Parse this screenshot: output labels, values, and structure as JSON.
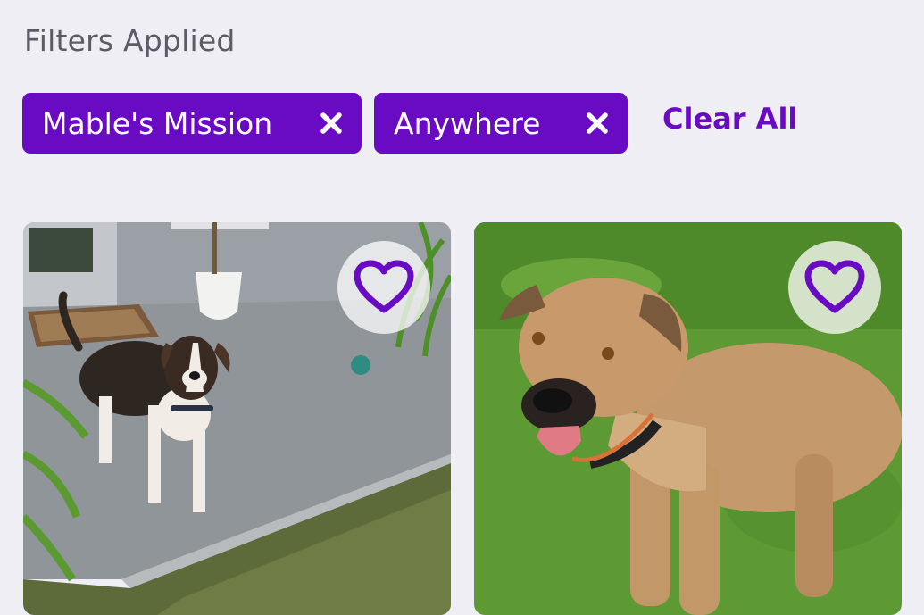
{
  "filters": {
    "title": "Filters Applied",
    "chips": [
      {
        "label": "Mable's Mission"
      },
      {
        "label": "Anywhere"
      }
    ],
    "clear_all_label": "Clear All"
  },
  "colors": {
    "accent": "#6a0bc4",
    "background": "#efeef4",
    "heading": "#5c5c66"
  },
  "cards": [
    {
      "photo": "brindle-white-dog-on-porch",
      "favorite_icon": "heart-outline-icon"
    },
    {
      "photo": "tan-dog-on-grass",
      "favorite_icon": "heart-outline-icon"
    }
  ]
}
